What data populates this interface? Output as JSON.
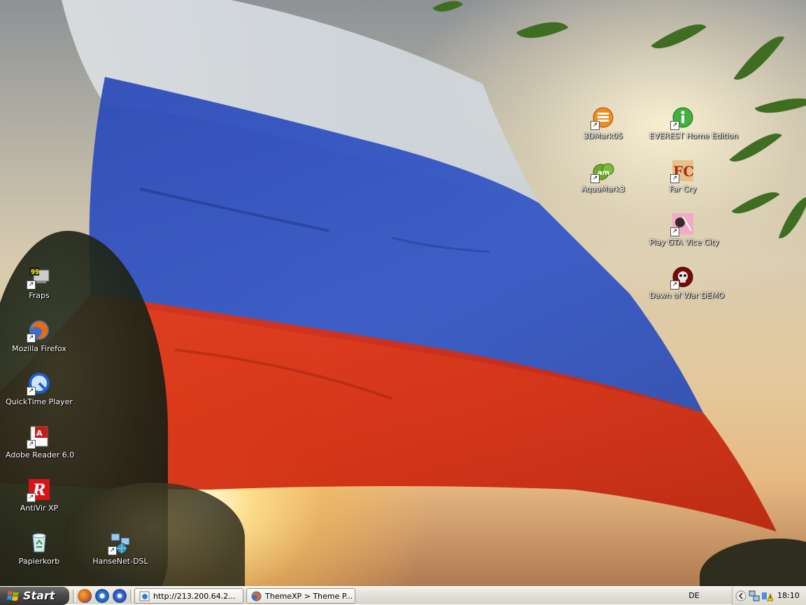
{
  "desktop": {
    "left_icons": [
      {
        "label": "Fraps",
        "icon": "fraps-icon"
      },
      {
        "label": "Mozilla Firefox",
        "icon": "firefox-icon"
      },
      {
        "label": "QuickTime Player",
        "icon": "quicktime-icon"
      },
      {
        "label": "Adobe Reader 6.0",
        "icon": "adobe-reader-icon"
      },
      {
        "label": "AntiVir XP",
        "icon": "antivir-icon"
      },
      {
        "label": "Papierkorb",
        "icon": "recycle-bin-icon"
      },
      {
        "label": "HanseNet-DSL",
        "icon": "network-connection-icon"
      }
    ],
    "right_icons": [
      {
        "label": "3DMark05",
        "icon": "3dmark-icon"
      },
      {
        "label": "EVEREST Home Edition",
        "icon": "everest-icon"
      },
      {
        "label": "AquaMark3",
        "icon": "aquamark-icon"
      },
      {
        "label": "Far Cry",
        "icon": "farcry-icon"
      },
      {
        "label": "Play GTA Vice City",
        "icon": "gta-vice-city-icon"
      },
      {
        "label": "Dawn of War DEMO",
        "icon": "dawn-of-war-icon"
      }
    ],
    "wallpaper": "russian-flag-sunset",
    "colors": {
      "flag_white": "#dfe6ee",
      "flag_blue": "#2f4fc0",
      "flag_red": "#d72c12"
    }
  },
  "taskbar": {
    "start_label": "Start",
    "quick_launch": [
      "firefox-icon",
      "internet-explorer-icon",
      "media-player-icon"
    ],
    "buttons": [
      {
        "label": "http://213.200.64.2...",
        "icon": "ie-page-icon"
      },
      {
        "label": "ThemeXP > Theme P...",
        "icon": "firefox-icon"
      }
    ],
    "language": "DE",
    "tray_icons": [
      "chevron-left-icon",
      "network-icon",
      "security-warning-icon"
    ],
    "clock": "18:10"
  }
}
